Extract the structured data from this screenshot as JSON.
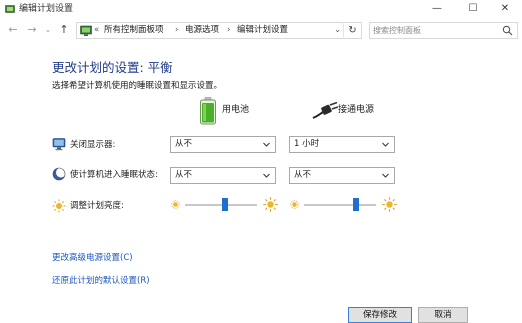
{
  "window": {
    "title": "编辑计划设置",
    "minimize_glyph": "—",
    "maximize_glyph": "☐",
    "close_glyph": "✕"
  },
  "nav": {
    "back_glyph": "←",
    "forward_glyph": "→",
    "dropdown_glyph": "⌄",
    "up_glyph": "↑"
  },
  "breadcrumb": {
    "prefix": "«",
    "items": [
      "所有控制面板项",
      "电源选项",
      "编辑计划设置"
    ],
    "separator": "›",
    "dropdown_glyph": "⌄",
    "refresh_glyph": "↻"
  },
  "search": {
    "placeholder": "搜索控制面板",
    "value": ""
  },
  "header": {
    "title": "更改计划的设置: 平衡",
    "subtitle": "选择希望计算机使用的睡眠设置和显示设置。"
  },
  "columns": {
    "battery_label": "用电池",
    "plugged_label": "接通电源"
  },
  "settings": {
    "display_off": {
      "label": "关闭显示器:",
      "battery_value": "从不",
      "plugged_value": "1 小时"
    },
    "sleep": {
      "label": "使计算机进入睡眠状态:",
      "battery_value": "从不",
      "plugged_value": "从不"
    },
    "brightness": {
      "label": "调整计划亮度:",
      "battery_level": 0.55,
      "plugged_level": 0.72
    }
  },
  "links": {
    "advanced": "更改高级电源设置(C)",
    "restore": "还原此计划的默认设置(R)"
  },
  "buttons": {
    "save": "保存修改",
    "cancel": "取消"
  },
  "colors": {
    "title_blue": "#1e3a8c",
    "link_blue": "#1a56c4",
    "slider_thumb": "#1e6fd0",
    "battery_green": "#4caf2a"
  }
}
